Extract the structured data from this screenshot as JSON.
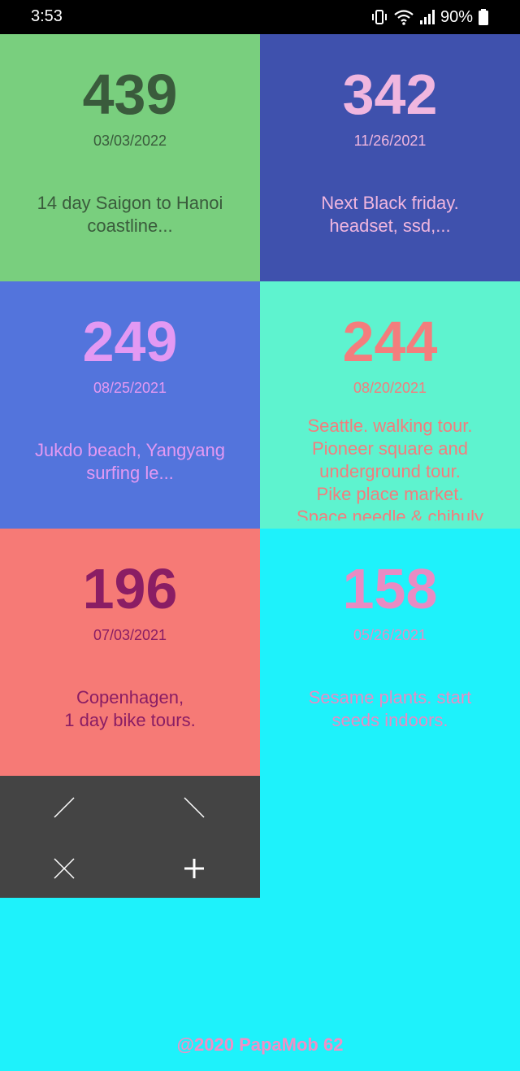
{
  "status_bar": {
    "time": "3:53",
    "battery": "90%",
    "icons": [
      "vibrate-icon",
      "wifi-icon",
      "signal-icon",
      "battery-icon"
    ]
  },
  "cards": [
    {
      "count": "439",
      "date": "03/03/2022",
      "note": "14 day Saigon to Hanoi\ncoastline...",
      "bg": "#79cf7e",
      "count_color": "#3a5b3c",
      "text_color": "#3a5b3c"
    },
    {
      "count": "342",
      "date": "11/26/2021",
      "note": "Next Black friday.\nheadset, ssd,...",
      "bg": "#3f51ad",
      "count_color": "#f0b6df",
      "text_color": "#f0b6df"
    },
    {
      "count": "249",
      "date": "08/25/2021",
      "note": "Jukdo beach, Yangyang\nsurfing le...",
      "bg": "#5374dc",
      "count_color": "#e399f3",
      "text_color": "#e399f3"
    },
    {
      "count": "244",
      "date": "08/20/2021",
      "note": "Seattle. walking tour.\nPioneer square and\nunderground tour.\nPike place market.\nSpace needle & chihuly",
      "bg": "#5ef3cf",
      "count_color": "#f37d7d",
      "text_color": "#f37d7d"
    },
    {
      "count": "196",
      "date": "07/03/2021",
      "note": "Copenhagen,\n1 day bike tours.",
      "bg": "#f67a76",
      "count_color": "#8a1d64",
      "text_color": "#8a1d64"
    },
    {
      "count": "158",
      "date": "05/26/2021",
      "note": "Sesame plants. start\nseeds indoors.",
      "bg": "#1ef2fb",
      "count_color": "#e98bc3",
      "text_color": "#e98bc3"
    }
  ],
  "controls": {
    "items": [
      "expand-diagonal-icon",
      "collapse-diagonal-icon",
      "close-icon",
      "add-icon"
    ]
  },
  "footer": {
    "text": "@2020 PapaMob 62"
  }
}
